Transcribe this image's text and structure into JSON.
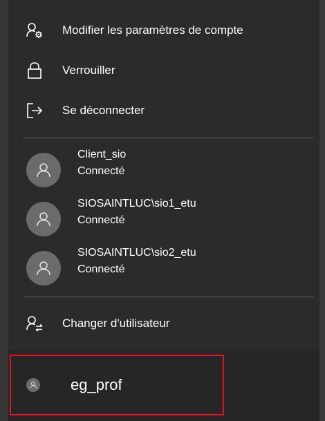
{
  "menu": {
    "items": [
      {
        "label": "Modifier les paramètres de compte",
        "icon": "person-settings-icon"
      },
      {
        "label": "Verrouiller",
        "icon": "lock-icon"
      },
      {
        "label": "Se déconnecter",
        "icon": "sign-out-icon"
      }
    ]
  },
  "users": [
    {
      "name": "Client_sio",
      "status": "Connecté",
      "icon": "user-avatar-icon"
    },
    {
      "name": "SIOSAINTLUC\\sio1_etu",
      "status": "Connecté",
      "icon": "user-avatar-icon"
    },
    {
      "name": "SIOSAINTLUC\\sio2_etu",
      "status": "Connecté",
      "icon": "user-avatar-icon"
    }
  ],
  "switch_user": {
    "label": "Changer d'utilisateur",
    "icon": "switch-user-icon"
  },
  "current_user": {
    "name": "eg_prof",
    "icon": "user-avatar-icon"
  },
  "colors": {
    "background": "#2b2b2b",
    "text": "#ffffff",
    "avatar": "#6b6b6b",
    "highlight_border": "#e81123"
  }
}
